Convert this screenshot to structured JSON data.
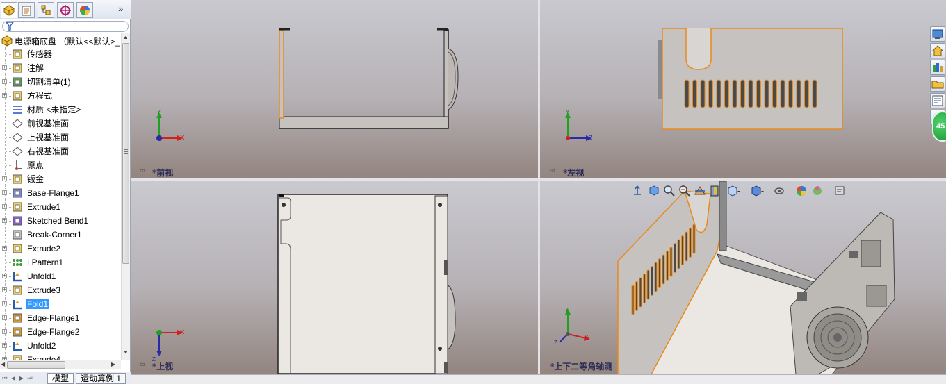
{
  "panel": {
    "tabs": [
      {
        "icon": "feature-manager-icon"
      },
      {
        "icon": "property-manager-icon"
      },
      {
        "icon": "configuration-manager-icon"
      },
      {
        "icon": "dimxpert-icon"
      },
      {
        "icon": "display-manager-icon"
      }
    ],
    "more_symbol": "»",
    "filter_icon": "filter-icon",
    "root_label": "电源箱底盘 （默认<<默认>_",
    "items": [
      {
        "label": "传感器",
        "icon": "sensor-icon",
        "expandable": false
      },
      {
        "label": "注解",
        "icon": "annotation-icon",
        "expandable": true
      },
      {
        "label": "切割清单(1)",
        "icon": "cut-list-icon",
        "expandable": true
      },
      {
        "label": "方程式",
        "icon": "equation-icon",
        "expandable": true
      },
      {
        "label": "材质 <未指定>",
        "icon": "material-icon",
        "expandable": false
      },
      {
        "label": "前视基准面",
        "icon": "plane-icon",
        "expandable": false
      },
      {
        "label": "上视基准面",
        "icon": "plane-icon",
        "expandable": false
      },
      {
        "label": "右视基准面",
        "icon": "plane-icon",
        "expandable": false
      },
      {
        "label": "原点",
        "icon": "origin-icon",
        "expandable": false
      },
      {
        "label": "钣金",
        "icon": "sheet-metal-icon",
        "expandable": true
      },
      {
        "label": "Base-Flange1",
        "icon": "base-flange-icon",
        "expandable": true
      },
      {
        "label": "Extrude1",
        "icon": "extrude-icon",
        "expandable": true
      },
      {
        "label": "Sketched Bend1",
        "icon": "sketched-bend-icon",
        "expandable": true
      },
      {
        "label": "Break-Corner1",
        "icon": "break-corner-icon",
        "expandable": false
      },
      {
        "label": "Extrude2",
        "icon": "extrude-icon",
        "expandable": true
      },
      {
        "label": "LPattern1",
        "icon": "linear-pattern-icon",
        "expandable": false
      },
      {
        "label": "Unfold1",
        "icon": "unfold-icon",
        "expandable": true
      },
      {
        "label": "Extrude3",
        "icon": "extrude-icon",
        "expandable": true
      },
      {
        "label": "Fold1",
        "icon": "fold-icon",
        "expandable": true,
        "selected": true
      },
      {
        "label": "Edge-Flange1",
        "icon": "edge-flange-icon",
        "expandable": true
      },
      {
        "label": "Edge-Flange2",
        "icon": "edge-flange-icon",
        "expandable": true
      },
      {
        "label": "Unfold2",
        "icon": "unfold-icon",
        "expandable": true
      },
      {
        "label": "Extrude4",
        "icon": "extrude-icon",
        "expandable": true
      }
    ],
    "bottom_tabs": [
      "模型",
      "运动算例 1"
    ]
  },
  "viewports": {
    "front": {
      "label": "*前视"
    },
    "left": {
      "label": "*左视"
    },
    "top": {
      "label": "*上视"
    },
    "iso": {
      "label": "*上下二等角轴测"
    }
  },
  "axes_labels": {
    "x": "X",
    "y": "Y",
    "z": "Z"
  },
  "hud_icons": [
    "view-orientation-icon",
    "zoom-to-fit-icon",
    "zoom-to-area-icon",
    "previous-view-icon",
    "section-view-icon",
    "view-orientation-menu-icon",
    "display-style-icon",
    "hide-show-items-icon",
    "edit-appearance-icon",
    "apply-scene-icon",
    "view-settings-icon"
  ],
  "task_pane_icons": [
    "solidworks-resources-icon",
    "home-icon",
    "design-library-icon",
    "file-explorer-icon",
    "view-palette-icon",
    "appearances-icon"
  ],
  "badge": {
    "text": "45"
  },
  "colors": {
    "edge_highlight": "#e88a1a",
    "part_face": "#c8c4c0",
    "background_top": "#c9c9cf",
    "background_bottom": "#93857f",
    "selection": "#3399ff"
  }
}
